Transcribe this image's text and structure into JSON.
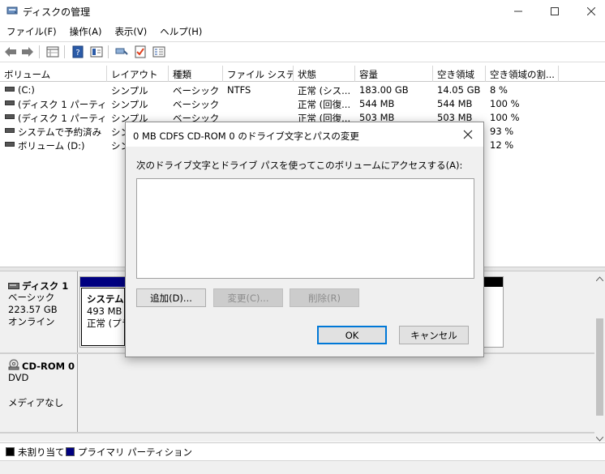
{
  "window": {
    "title": "ディスクの管理",
    "controls": {
      "minimize": "—",
      "maximize": "☐",
      "close": "✕"
    }
  },
  "menu": [
    "ファイル(F)",
    "操作(A)",
    "表示(V)",
    "ヘルプ(H)"
  ],
  "toolbar": {
    "icons": [
      "back-arrow-icon",
      "forward-arrow-icon",
      "properties-grid-icon",
      "help-icon",
      "help-panel-icon",
      "connect-icon",
      "checklist-icon",
      "properties-icon"
    ]
  },
  "volume_table": {
    "columns": [
      "ボリューム",
      "レイアウト",
      "種類",
      "ファイル システム",
      "状態",
      "容量",
      "空き領域",
      "空き領域の割..."
    ],
    "rows": [
      [
        "(C:)",
        "シンプル",
        "ベーシック",
        "NTFS",
        "正常 (シス...",
        "183.00 GB",
        "14.05 GB",
        "8 %"
      ],
      [
        "(ディスク 1 パーティシ...",
        "シンプル",
        "ベーシック",
        "",
        "正常 (回復...",
        "544 MB",
        "544 MB",
        "100 %"
      ],
      [
        "(ディスク 1 パーティシ...",
        "シンプル",
        "ベーシック",
        "",
        "正常 (回復...",
        "503 MB",
        "503 MB",
        "100 %"
      ],
      [
        "システムで予約済み",
        "シン",
        "",
        "",
        "",
        "",
        "",
        "93 %"
      ],
      [
        "ボリューム (D:)",
        "シン",
        "",
        "",
        "",
        "",
        "",
        "12 %"
      ]
    ]
  },
  "disks": [
    {
      "name": "ディスク 1",
      "type": "ベーシック",
      "size": "223.57 GB",
      "status": "オンライン",
      "partition": {
        "name": "システムで",
        "size": "493 MB N",
        "state": "正常 (プラ"
      }
    },
    {
      "name": "CD-ROM 0",
      "type": "DVD",
      "size": "",
      "status": "メディアなし"
    }
  ],
  "legend": [
    {
      "label": "未割り当て",
      "color": "#000000"
    },
    {
      "label": "プライマリ パーティション",
      "color": "#000080"
    }
  ],
  "dialog": {
    "title": "0 MB CDFS  CD-ROM 0 のドライブ文字とパスの変更",
    "description": "次のドライブ文字とドライブ パスを使ってこのボリュームにアクセスする(A):",
    "buttons": {
      "add": "追加(D)...",
      "change": "変更(C)...",
      "remove": "削除(R)",
      "ok": "OK",
      "cancel": "キャンセル"
    }
  },
  "colors": {
    "primary_partition": "#000080",
    "unallocated": "#000000",
    "accent": "#0078d7"
  }
}
